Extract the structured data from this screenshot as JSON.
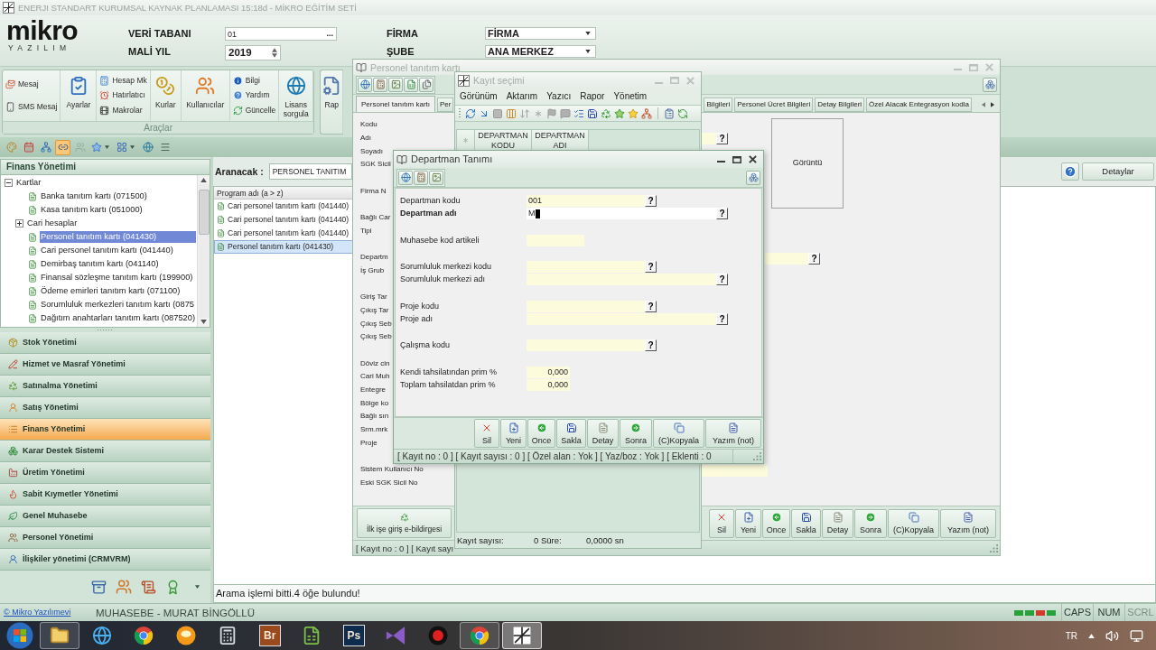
{
  "app_title": "ENERJI STANDART KURUMSAL KAYNAK PLANLAMASI 15:18d - MİKRO EĞİTİM SETİ",
  "logo": {
    "wordmark": "mikro",
    "tagline": "YAZILIM"
  },
  "header": {
    "fields": [
      {
        "label": "VERİ TABANI",
        "value": "01",
        "kind": "browse",
        "button": "..."
      },
      {
        "label": "FİRMA",
        "value": "FİRMA",
        "kind": "dropdown"
      },
      {
        "label": "MALİ YIL",
        "value": "2019",
        "kind": "spin"
      },
      {
        "label": "ŞUBE",
        "value": "ANA MERKEZ",
        "kind": "dropdown"
      }
    ]
  },
  "ribbon": {
    "groups": [
      {
        "label": "Araçlar",
        "columns": [
          {
            "kind": "stack",
            "items": [
              "Mesaj",
              "SMS Mesaj"
            ]
          },
          {
            "kind": "large",
            "label": "Ayarlar"
          },
          {
            "kind": "stack",
            "items": [
              "Hesap Mk",
              "Hatırlatıcı",
              "Makrolar"
            ]
          },
          {
            "kind": "large",
            "label": "Kurlar"
          },
          {
            "kind": "large",
            "label": "Kullanıcılar"
          },
          {
            "kind": "stack",
            "items": [
              "Bilgi",
              "Yardım",
              "Güncelle"
            ]
          },
          {
            "kind": "large",
            "label": "Lisans sorgula"
          }
        ]
      },
      {
        "columns": [
          {
            "kind": "large",
            "label": "Rap"
          }
        ]
      }
    ]
  },
  "quick_toolbar": [
    {
      "selected": false,
      "disabled": false,
      "dropdown": false
    },
    {
      "selected": false,
      "disabled": false,
      "dropdown": false
    },
    {
      "selected": false,
      "disabled": false,
      "dropdown": false
    },
    {
      "selected": true,
      "disabled": false,
      "dropdown": false
    },
    {
      "selected": false,
      "disabled": true,
      "dropdown": false
    },
    {
      "selected": false,
      "disabled": false,
      "dropdown": true
    },
    {
      "selected": false,
      "disabled": false,
      "dropdown": true
    },
    {
      "selected": false,
      "disabled": false,
      "dropdown": false
    },
    {
      "selected": false,
      "disabled": false,
      "dropdown": false
    }
  ],
  "nav_panel": {
    "title": "Finans Yönetimi",
    "tree": [
      {
        "label": "Kartlar",
        "kind": "group",
        "expanded": true,
        "selected": false,
        "children": [
          {
            "label": "Banka tanıtım kartı (071500)",
            "kind": "card",
            "selected": false
          },
          {
            "label": "Kasa tanıtım kartı (051000)",
            "kind": "card",
            "selected": false
          },
          {
            "label": "Cari hesaplar",
            "kind": "group",
            "expanded": false,
            "selected": false
          },
          {
            "label": "Personel tanıtım kartı (041430)",
            "kind": "card",
            "selected": true
          },
          {
            "label": "Cari personel tanıtım kartı (041440)",
            "kind": "card",
            "selected": false
          },
          {
            "label": "Demirbaş tanıtım kartı (041140)",
            "kind": "card",
            "selected": false
          },
          {
            "label": "Finansal sözleşme tanıtım kartı (199900)",
            "kind": "card",
            "selected": false
          },
          {
            "label": "Ödeme emirleri tanıtım kartı (071100)",
            "kind": "card",
            "selected": false
          },
          {
            "label": "Sorumluluk merkezleri tanıtım kartı (0875",
            "kind": "card",
            "selected": false
          },
          {
            "label": "Dağıtım anahtarları tanıtım kartı (087520)",
            "kind": "card",
            "selected": false
          }
        ]
      }
    ],
    "modules": [
      {
        "label": "Stok Yönetimi",
        "selected": false
      },
      {
        "label": "Hizmet ve Masraf Yönetimi",
        "selected": false
      },
      {
        "label": "Satınalma Yönetimi",
        "selected": false
      },
      {
        "label": "Satış Yönetimi",
        "selected": false
      },
      {
        "label": "Finans Yönetimi",
        "selected": true
      },
      {
        "label": "Karar Destek Sistemi",
        "selected": false
      },
      {
        "label": "Üretim Yönetimi",
        "selected": false
      },
      {
        "label": "Sabit Kıymetler Yönetimi",
        "selected": false
      },
      {
        "label": "Genel Muhasebe",
        "selected": false
      },
      {
        "label": "Personel Yönetimi",
        "selected": false
      },
      {
        "label": "İlişkiler yönetimi (CRMVRM)",
        "selected": false
      }
    ]
  },
  "search": {
    "label": "Aranacak :",
    "value": "PERSONEL TANITIM"
  },
  "details_button": "Detaylar",
  "results": {
    "column": "Program adı (a > z)",
    "rows": [
      {
        "label": "Cari personel tanıtım kartı (041440)",
        "selected": false
      },
      {
        "label": "Cari personel tanıtım kartı (041440)",
        "selected": false
      },
      {
        "label": "Cari personel tanıtım kartı (041440)",
        "selected": false
      },
      {
        "label": "Personel tanıtım kartı (041430)",
        "selected": true
      }
    ]
  },
  "status_message": "Arama işlemi bitti.4 öğe bulundu!",
  "status_bar": {
    "link": "© Mikro Yazılımevi",
    "user": "MUHASEBE - MURAT BİNGÖLLÜ",
    "keys": [
      {
        "label": "CAPS",
        "on": true
      },
      {
        "label": "NUM",
        "on": true
      },
      {
        "label": "SCRL",
        "on": false
      }
    ]
  },
  "taskbar": {
    "apps": [
      {
        "kind": "folder",
        "running": true,
        "selected": false
      },
      {
        "kind": "globe",
        "running": false,
        "selected": false
      },
      {
        "kind": "wheel",
        "running": false,
        "selected": false
      },
      {
        "kind": "orb",
        "running": false,
        "selected": false
      },
      {
        "kind": "calculator",
        "running": false,
        "selected": false
      },
      {
        "kind": "letters",
        "text": "Br",
        "color": "#9a4a1c",
        "running": false,
        "selected": false
      },
      {
        "kind": "sheet",
        "running": false,
        "selected": false
      },
      {
        "kind": "letters",
        "text": "Ps",
        "color": "#0e2c4e",
        "running": false,
        "selected": false
      },
      {
        "kind": "bow",
        "running": false,
        "selected": false
      },
      {
        "kind": "record",
        "running": false,
        "selected": false
      },
      {
        "kind": "wheel",
        "running": true,
        "selected": false
      },
      {
        "kind": "crosshair",
        "running": true,
        "selected": true
      }
    ],
    "language": "TR"
  },
  "personnel_window": {
    "title": "Personel tanıtım kartı",
    "active": false,
    "tabs": [
      {
        "label": "Personel tanıtım kartı",
        "selected": true
      },
      {
        "label": "Per",
        "selected": false
      },
      {
        "label": "Bilgileri",
        "selected": false
      },
      {
        "label": "Personel Ücret Bilgileri",
        "selected": false
      },
      {
        "label": "Detay Bilgileri",
        "selected": false
      },
      {
        "label": "Özel Alacak Entegrasyon kodla",
        "selected": false
      }
    ],
    "label_groups": [
      {
        "items": [
          "Kodu",
          "Adı",
          "Soyadı",
          "SGK Sicil"
        ]
      },
      {
        "items": [
          "Firma N"
        ]
      },
      {
        "items": [
          "Bağlı Car",
          "Tipi"
        ]
      },
      {
        "items": [
          "Departm",
          "İş Grub"
        ]
      },
      {
        "items": [
          "Giriş Tar",
          "Çıkış Tar",
          "Çıkış Seb",
          "Çıkış Seb"
        ]
      },
      {
        "items": [
          "Döviz cin",
          "Cari Muh",
          "Entegre",
          "Bölge ko",
          "Bağlı sın",
          "Srm.mrk",
          "Proje"
        ]
      },
      {
        "items": [
          "Sistem Kullanıcı No",
          "Eski SGK Sicil No"
        ]
      }
    ],
    "side_fields": [
      {
        "kind": "stub",
        "lookup": "?"
      },
      {
        "kind": "wide",
        "lookup": "?"
      },
      {
        "kind": "plain"
      }
    ],
    "image_box": "Görüntü",
    "declaration_button": "İlk işe giriş e-bildirgesi",
    "buttons": [
      {
        "label": "Sil",
        "kind": "delete"
      },
      {
        "label": "Yeni",
        "kind": "new"
      },
      {
        "label": "Once",
        "kind": "previous"
      },
      {
        "label": "Sakla",
        "kind": "save"
      },
      {
        "label": "Detay",
        "kind": "detail"
      },
      {
        "label": "Sonra",
        "kind": "next"
      },
      {
        "label": "(C)Kopyala",
        "kind": "copy"
      },
      {
        "label": "Yazım (not)",
        "kind": "note"
      }
    ],
    "status": "[ Kayıt no : 0 ] [ Kayıt sayı"
  },
  "record_selection_window": {
    "title": "Kayıt seçimi",
    "active": false,
    "menu": [
      "Görünüm",
      "Aktarım",
      "Yazıcı",
      "Rapor",
      "Yönetim"
    ],
    "columns": [
      "DEPARTMAN KODU",
      "DEPARTMAN ADI"
    ],
    "footer": {
      "count_label": "Kayıt sayısı:",
      "count": "0",
      "time_label": "Süre:",
      "time": "0,0000 sn"
    }
  },
  "department_dialog": {
    "title": "Departman Tanımı",
    "active": true,
    "field_groups": [
      {
        "fields": [
          {
            "label": "Departman kodu",
            "value": "001",
            "kind": "code",
            "lookup": "?",
            "required": false,
            "focused": false
          },
          {
            "label": "Departman adı",
            "value": "M",
            "kind": "name",
            "lookup": "?",
            "required": true,
            "focused": true
          }
        ]
      },
      {
        "fields": [
          {
            "label": "Muhasebe kod artikeli",
            "kind": "short",
            "required": false,
            "focused": false
          }
        ]
      },
      {
        "fields": [
          {
            "label": "Sorumluluk merkezi kodu",
            "kind": "code",
            "lookup": "?",
            "required": false,
            "focused": false
          },
          {
            "label": "Sorumluluk merkezi adı",
            "kind": "name",
            "lookup": "?",
            "required": false,
            "focused": false
          }
        ]
      },
      {
        "fields": [
          {
            "label": "Proje kodu",
            "kind": "code",
            "lookup": "?",
            "required": false,
            "focused": false
          },
          {
            "label": "Proje adı",
            "kind": "name",
            "lookup": "?",
            "required": false,
            "focused": false
          }
        ]
      },
      {
        "fields": [
          {
            "label": "Çalışma kodu",
            "kind": "code",
            "lookup": "?",
            "required": false,
            "focused": false
          }
        ]
      },
      {
        "fields": [
          {
            "label": "Kendi tahsilatından prim %",
            "value": "0,000",
            "kind": "number",
            "required": false,
            "focused": false
          },
          {
            "label": "Toplam tahsilatdan prim %",
            "value": "0,000",
            "kind": "number",
            "required": false,
            "focused": false
          }
        ]
      }
    ],
    "buttons": [
      {
        "label": "Sil",
        "kind": "delete"
      },
      {
        "label": "Yeni",
        "kind": "new"
      },
      {
        "label": "Once",
        "kind": "previous"
      },
      {
        "label": "Sakla",
        "kind": "save"
      },
      {
        "label": "Detay",
        "kind": "detail"
      },
      {
        "label": "Sonra",
        "kind": "next"
      },
      {
        "label": "(C)Kopyala",
        "kind": "copy"
      },
      {
        "label": "Yazım (not)",
        "kind": "note"
      }
    ],
    "status": "[ Kayıt no : 0 ] [ Kayıt sayısı : 0 ] [ Özel alan : Yok ] [ Yaz/boz : Yok ] [ Eklenti : 0"
  }
}
